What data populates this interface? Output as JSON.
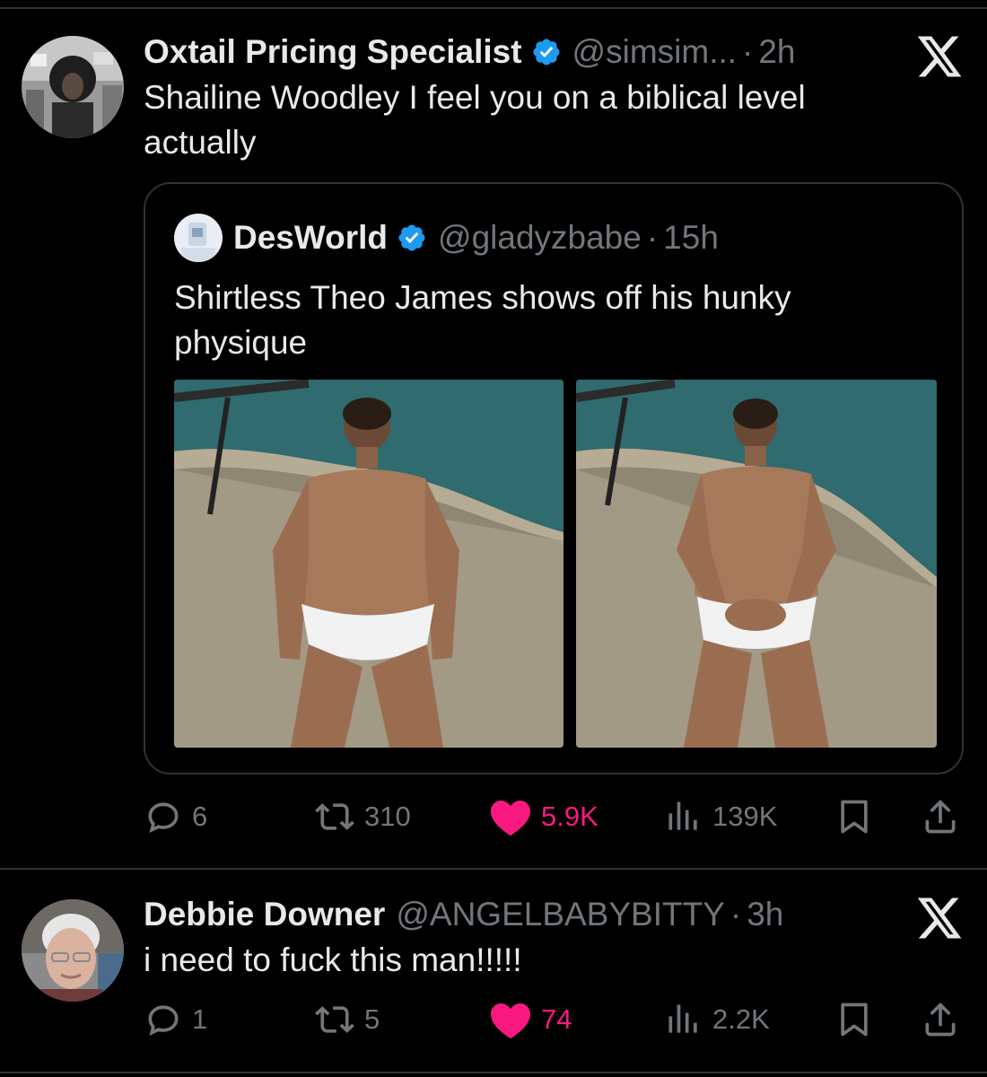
{
  "tweets": [
    {
      "author_name": "Oxtail Pricing Specialist",
      "handle": "@simsim...",
      "time": "2h",
      "text": "Shailine Woodley I feel you on a biblical level\nactually",
      "quote": {
        "author_name": "DesWorld",
        "handle": "@gladyzbabe",
        "time": "15h",
        "text": "Shirtless Theo James shows off his hunky\nphysique"
      },
      "stats": {
        "replies": "6",
        "retweets": "310",
        "likes": "5.9K",
        "views": "139K"
      }
    },
    {
      "author_name": "Debbie Downer",
      "handle": "@ANGELBABYBITTY",
      "time": "3h",
      "text": "i need to fuck this man!!!!!",
      "stats": {
        "replies": "1",
        "retweets": "5",
        "likes": "74",
        "views": "2.2K"
      }
    }
  ],
  "separator": "·",
  "colors": {
    "verified": "#1d9bf0",
    "like": "#f91880",
    "muted": "#71767b",
    "text": "#e7e9ea"
  }
}
